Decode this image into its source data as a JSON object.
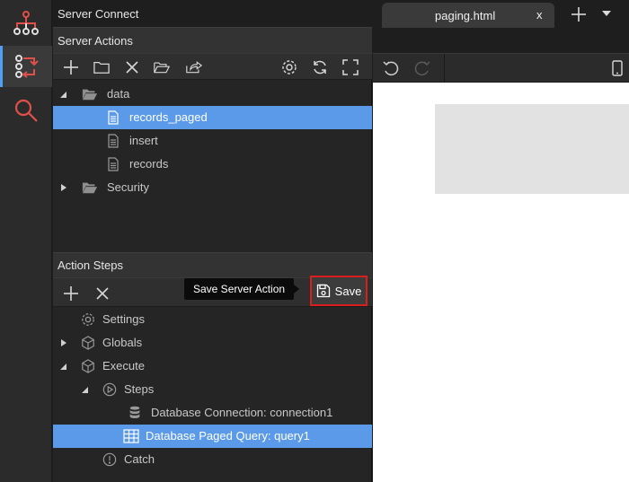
{
  "sidebar": {
    "icons": [
      "sitemap-icon",
      "server-connect-icon",
      "search-icon"
    ]
  },
  "panel": {
    "title": "Server Connect",
    "server_actions_header": "Server Actions",
    "action_steps_header": "Action Steps",
    "server_tree": [
      {
        "label": "data",
        "icon": "folder-open-icon",
        "expanded": true
      },
      {
        "label": "records_paged",
        "icon": "file-icon",
        "selected": true
      },
      {
        "label": "insert",
        "icon": "file-icon"
      },
      {
        "label": "records",
        "icon": "file-icon"
      },
      {
        "label": "Security",
        "icon": "folder-open-icon",
        "expanded": false
      }
    ],
    "steps_tree": [
      {
        "label": "Settings",
        "icon": "gear-icon"
      },
      {
        "label": "Globals",
        "icon": "cube-icon",
        "expanded": false
      },
      {
        "label": "Execute",
        "icon": "cube-icon",
        "expanded": true
      },
      {
        "label": "Steps",
        "icon": "play-circle-icon",
        "expanded": true
      },
      {
        "label": "Database Connection: connection1",
        "icon": "database-icon"
      },
      {
        "label": "Database Paged Query: query1",
        "icon": "table-icon",
        "selected": true
      },
      {
        "label": "Catch",
        "icon": "alert-circle-icon"
      }
    ],
    "tooltip": "Save Server Action",
    "save_label": "Save"
  },
  "editor": {
    "tab_title": "paging.html",
    "tab_close": "x"
  },
  "colors": {
    "selection": "#5a9ae8",
    "highlight_border": "#d91e1e",
    "accent": "#4e9ff5",
    "rail_red": "#e0504a"
  }
}
